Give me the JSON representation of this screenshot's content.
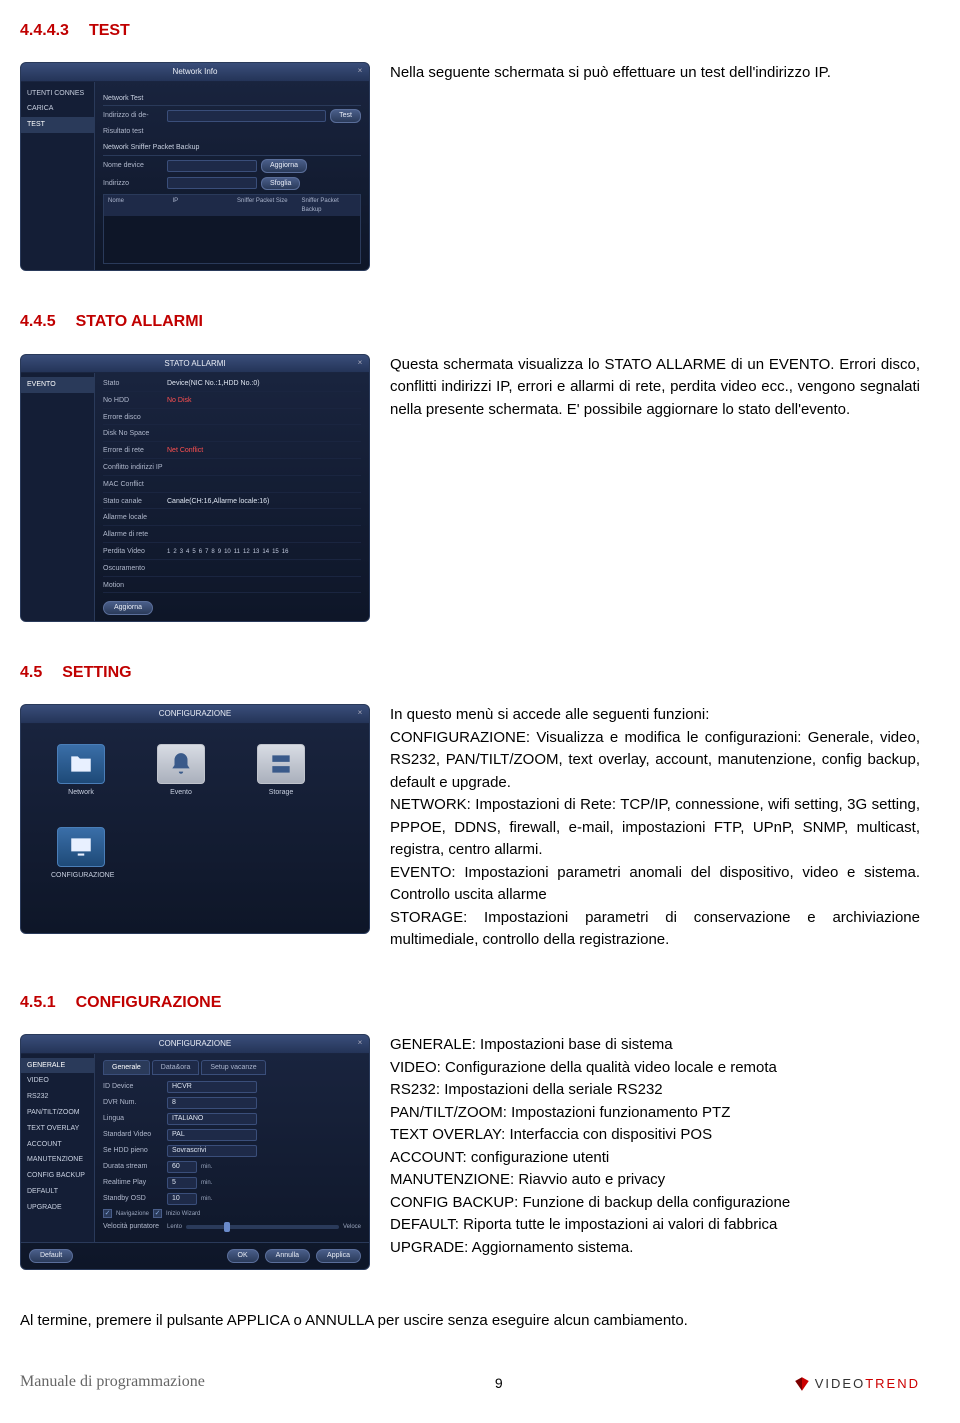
{
  "sections": {
    "s1": {
      "num": "4.4.4.3",
      "title": "TEST",
      "body": "Nella seguente schermata si può effettuare un test dell'indirizzo IP."
    },
    "s2": {
      "num": "4.4.5",
      "title": "STATO ALLARMI",
      "body": "Questa schermata visualizza lo STATO ALLARME di un EVENTO. Errori disco, conflitti indirizzi IP, errori e allarmi di rete, perdita video ecc., vengono segnalati nella presente schermata. E' possibile aggiornare lo stato dell'evento."
    },
    "s3": {
      "num": "4.5",
      "title": "SETTING",
      "body": "In questo menù si accede alle seguenti funzioni:\nCONFIGURAZIONE: Visualizza e modifica le configurazioni: Generale, video, RS232, PAN/TILT/ZOOM, text overlay, account, manutenzione, config backup, default e upgrade.\nNETWORK: Impostazioni di Rete: TCP/IP, connessione, wifi setting, 3G setting, PPPOE, DDNS, firewall, e-mail, impostazioni FTP, UPnP, SNMP, multicast, registra, centro allarmi.\nEVENTO: Impostazioni parametri anomali del dispositivo, video e sistema. Controllo uscita allarme\nSTORAGE: Impostazioni parametri di conservazione e archiviazione multimediale, controllo della registrazione."
    },
    "s4": {
      "num": "4.5.1",
      "title": "CONFIGURAZIONE",
      "body": "GENERALE: Impostazioni base di sistema\nVIDEO: Configurazione della qualità video locale e remota\nRS232: Impostazioni della seriale RS232\nPAN/TILT/ZOOM: Impostazioni funzionamento PTZ\nTEXT OVERLAY: Interfaccia con dispositivi POS\nACCOUNT: configurazione utenti\nMANUTENZIONE: Riavvio auto e privacy\nCONFIG BACKUP: Funzione di backup della configurazione\nDEFAULT: Riporta tutte le impostazioni ai valori di fabbrica\nUPGRADE: Aggiornamento sistema."
    }
  },
  "footnote": "Al termine, premere il pulsante APPLICA o ANNULLA per uscire senza eseguire alcun cambiamento.",
  "footer": {
    "left": "Manuale di programmazione",
    "page": "9",
    "brand_prefix": "VIDEO",
    "brand_suffix": "TREND"
  },
  "win1": {
    "title": "Network Info",
    "side": [
      "UTENTI CONNES",
      "CARICA",
      "TEST"
    ],
    "sub1": "Network Test",
    "rows": {
      "r1": "Indirizzo di de-",
      "r2": "Risultato test"
    },
    "btn_test": "Test",
    "sub2": "Network Sniffer Packet Backup",
    "rows2": {
      "r1": "Nome device",
      "r2": "Indirizzo"
    },
    "btn_agg": "Aggiorna",
    "btn_sfo": "Sfoglia",
    "th": [
      "Nome",
      "IP",
      "Sniffer Packet Size",
      "Sniffer Packet Backup"
    ]
  },
  "win2": {
    "title": "STATO ALLARMI",
    "side": [
      "EVENTO"
    ],
    "rows": {
      "r1l": "Stato",
      "r1v": "Device(NIC No.:1,HDD No.:0)",
      "r2l": "No HDD",
      "r2v": "No Disk",
      "r3l": "Errore disco",
      "r4l": "Disk No Space",
      "r5l": "Errore di rete",
      "r5v": "Net Conflict",
      "r6l": "Conflitto indirizzi IP",
      "r7l": "MAC Conflict",
      "r8l": "Stato canale",
      "r8v": "Canale(CH:16,Allarme locale:16)",
      "r9l": "Allarme locale",
      "r10l": "Allarme di rete",
      "r11l": "Perdita Video",
      "r12l": "Oscuramento",
      "r13l": "Motion"
    },
    "nums": [
      "1",
      "2",
      "3",
      "4",
      "5",
      "6",
      "7",
      "8",
      "9",
      "10",
      "11",
      "12",
      "13",
      "14",
      "15",
      "16"
    ],
    "btn_agg": "Aggiorna"
  },
  "win3": {
    "title": "CONFIGURAZIONE",
    "icons": {
      "net": "Network",
      "evt": "Evento",
      "sto": "Storage",
      "cfg": "CONFIGURAZIONE"
    }
  },
  "win4": {
    "title": "CONFIGURAZIONE",
    "side": [
      "GENERALE",
      "VIDEO",
      "RS232",
      "PAN/TILT/ZOOM",
      "TEXT OVERLAY",
      "ACCOUNT",
      "MANUTENZIONE",
      "CONFIG BACKUP",
      "DEFAULT",
      "UPGRADE"
    ],
    "tabs": [
      "Generale",
      "Data&ora",
      "Setup vacanze"
    ],
    "rows": {
      "id": "ID Device",
      "id_v": "HCVR",
      "dvr": "DVR Num.",
      "dvr_v": "8",
      "lang": "Lingua",
      "lang_v": "ITALIANO",
      "std": "Standard Video",
      "std_v": "PAL",
      "hdd": "Se HDD pieno",
      "hdd_v": "Sovrascrivi",
      "dur": "Durata stream",
      "dur_v": "60",
      "dur_u": "min.",
      "rt": "Realtime Play",
      "rt_v": "5",
      "rt_u": "min.",
      "osd": "Standby OSD",
      "osd_v": "10",
      "osd_u": "min.",
      "nav": "Navigazione",
      "wiz": "Inizio Wizard",
      "vel": "Velocità puntatore",
      "vel_l": "Lento",
      "vel_r": "Veloce"
    },
    "btns": {
      "def": "Default",
      "ok": "OK",
      "ann": "Annulla",
      "app": "Applica"
    }
  }
}
